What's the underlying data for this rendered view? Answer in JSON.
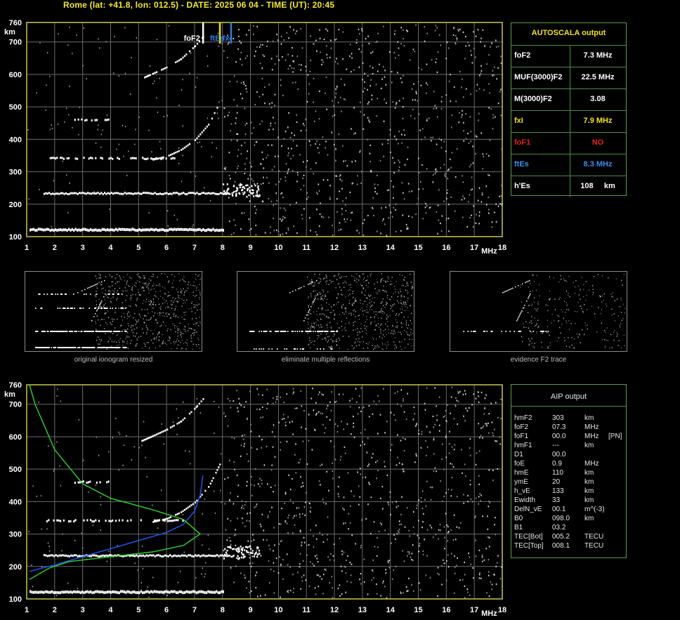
{
  "header": {
    "station": "Rome",
    "coords": "(lat: +41.8, lon: 012.5)",
    "date_label": "DATE:",
    "date": "2025 06 04",
    "time_label": "TIME (UT):",
    "time": "20:45",
    "full": "Rome (lat: +41.8, lon: 012.5) - DATE: 2025 06 04 - TIME (UT): 20:45"
  },
  "colors": {
    "frame": "#c8c84a",
    "grid": "#6b6b6b",
    "trace": "#ffffff",
    "foF2_marker": "#ffffff",
    "fxI_marker": "#f2e21a",
    "ftEs_marker": "#2f7fe0",
    "profile_blue": "#1f5cff",
    "profile_green": "#2fd42f",
    "value_yellow": "#f2e21a",
    "value_red": "#e81e1e",
    "value_blue": "#3c8cf0"
  },
  "ionogram_top": {
    "ylabel": "km",
    "xlabel": "MHz",
    "x_ticks": [
      "1",
      "2",
      "3",
      "4",
      "5",
      "6",
      "7",
      "8",
      "9",
      "10",
      "11",
      "12",
      "13",
      "14",
      "15",
      "16",
      "17",
      "18"
    ],
    "y_ticks": [
      "100",
      "200",
      "300",
      "400",
      "500",
      "600",
      "700",
      "760"
    ],
    "markers": {
      "foF2": "foF2",
      "ftEs": "ftEs",
      "fx": "fx"
    }
  },
  "autoscala": {
    "title": "AUTOSCALA output",
    "rows": [
      {
        "label": "foF2",
        "value": "7.3 MHz",
        "color": "#ffffff"
      },
      {
        "label": "MUF(3000)F2",
        "value": "22.5 MHz",
        "color": "#ffffff"
      },
      {
        "label": "M(3000)F2",
        "value": "3.08",
        "color": "#ffffff"
      },
      {
        "label": "fxI",
        "value": "7.9 MHz",
        "color": "#f2e21a"
      },
      {
        "label": "foF1",
        "value": "NO",
        "color": "#e81e1e"
      },
      {
        "label": "ftEs",
        "value": "8.3 MHz",
        "color": "#3c8cf0"
      },
      {
        "label": "h'Es",
        "value": "108     km",
        "color": "#ffffff"
      }
    ]
  },
  "thumbnails": {
    "captions": [
      "original ionogram resized",
      "eliminate multiple reflections",
      "evidence F2 trace"
    ]
  },
  "ionogram_bottom": {
    "ylabel": "km",
    "xlabel": "MHz",
    "x_ticks": [
      "1",
      "2",
      "3",
      "4",
      "5",
      "6",
      "7",
      "8",
      "9",
      "10",
      "11",
      "12",
      "13",
      "14",
      "15",
      "16",
      "17",
      "18"
    ],
    "y_ticks": [
      "100",
      "200",
      "300",
      "400",
      "500",
      "600",
      "700",
      "760"
    ]
  },
  "aip": {
    "title": "AIP output",
    "rows": [
      {
        "name": "hmF2",
        "value": "303",
        "unit": "km",
        "extra": ""
      },
      {
        "name": "foF2",
        "value": "07.3",
        "unit": "MHz",
        "extra": ""
      },
      {
        "name": "foF1",
        "value": "00.0",
        "unit": "MHz",
        "extra": "[PN]"
      },
      {
        "name": "hmF1",
        "value": "---",
        "unit": "km",
        "extra": ""
      },
      {
        "name": "D1",
        "value": "00.0",
        "unit": "",
        "extra": ""
      },
      {
        "name": "foE",
        "value": "0.9",
        "unit": "MHz",
        "extra": ""
      },
      {
        "name": "hmE",
        "value": "110",
        "unit": "km",
        "extra": ""
      },
      {
        "name": "ymE",
        "value": "20",
        "unit": "km",
        "extra": ""
      },
      {
        "name": "h_vE",
        "value": "133",
        "unit": "km",
        "extra": ""
      },
      {
        "name": "Ewidth",
        "value": "33",
        "unit": "km",
        "extra": ""
      },
      {
        "name": "DelN_vE",
        "value": "00.1",
        "unit": "m^(-3)",
        "extra": ""
      },
      {
        "name": "B0",
        "value": "098.0",
        "unit": "km",
        "extra": ""
      },
      {
        "name": "B1",
        "value": "03.2",
        "unit": "",
        "extra": ""
      },
      {
        "name": "TEC[Bot]",
        "value": "005.2",
        "unit": "TECU",
        "extra": ""
      },
      {
        "name": "TEC[Top]",
        "value": "008.1",
        "unit": "TECU",
        "extra": ""
      }
    ]
  },
  "chart_data": [
    {
      "type": "scatter",
      "panel": "top ionogram",
      "xlabel": "MHz",
      "ylabel": "km",
      "xlim": [
        1,
        18
      ],
      "ylim": [
        100,
        760
      ],
      "grid": true,
      "traces": [
        {
          "name": "Es",
          "x_range": [
            1.1,
            8.0
          ],
          "h": 121
        },
        {
          "name": "F echo 230",
          "x_range": [
            1.6,
            8.2
          ],
          "h": 233
        },
        {
          "name": "2nd hop",
          "x_range": [
            1.7,
            6.6
          ],
          "h": 341
        },
        {
          "name": "3rd hop",
          "x_range": [
            2.7,
            4.0
          ],
          "h": 460
        },
        {
          "name": "F2 trace o",
          "points": [
            [
              5.1,
              590
            ],
            [
              5.5,
              605
            ],
            [
              6.0,
              625
            ],
            [
              6.5,
              650
            ],
            [
              7.0,
              690
            ],
            [
              7.3,
              720
            ]
          ]
        },
        {
          "name": "F2 trace x",
          "points": [
            [
              5.5,
              340
            ],
            [
              6.0,
              350
            ],
            [
              6.5,
              370
            ],
            [
              7.0,
              400
            ],
            [
              7.5,
              450
            ],
            [
              7.9,
              520
            ]
          ]
        }
      ],
      "vertical_markers": [
        {
          "label": "foF2",
          "x": 7.3
        },
        {
          "label": "fxI",
          "x": 7.9
        },
        {
          "label": "ftEs",
          "x": 8.3
        }
      ]
    },
    {
      "type": "line",
      "panel": "bottom ionogram with AIP profile",
      "xlabel": "MHz",
      "ylabel": "km",
      "xlim": [
        1,
        18
      ],
      "ylim": [
        100,
        760
      ],
      "grid": true,
      "series": [
        {
          "points": [
            [
              1.1,
              185
            ],
            [
              2.0,
              205
            ],
            [
              3.0,
              230
            ],
            [
              4.0,
              255
            ],
            [
              5.0,
              280
            ],
            [
              6.0,
              305
            ],
            [
              6.6,
              330
            ],
            [
              7.0,
              370
            ],
            [
              7.2,
              420
            ],
            [
              7.3,
              480
            ]
          ]
        },
        {
          "points": [
            [
              1.1,
              160
            ],
            [
              1.8,
              195
            ],
            [
              2.5,
              215
            ],
            [
              4.0,
              230
            ],
            [
              5.5,
              245
            ],
            [
              6.6,
              265
            ],
            [
              7.2,
              300
            ],
            [
              6.6,
              345
            ],
            [
              5.5,
              375
            ],
            [
              4.0,
              410
            ],
            [
              3.0,
              455
            ],
            [
              2.0,
              560
            ],
            [
              1.3,
              700
            ],
            [
              1.1,
              760
            ]
          ]
        }
      ]
    }
  ]
}
